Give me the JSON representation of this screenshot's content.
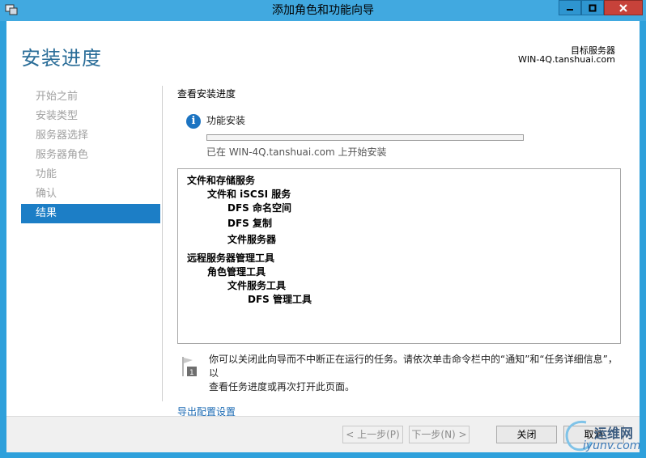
{
  "window": {
    "title": "添加角色和功能向导"
  },
  "header": {
    "title": "安装进度",
    "destination_label": "目标服务器",
    "destination_value": "WIN-4Q.tanshuai.com"
  },
  "nav": {
    "items": [
      {
        "label": "开始之前"
      },
      {
        "label": "安装类型"
      },
      {
        "label": "服务器选择"
      },
      {
        "label": "服务器角色"
      },
      {
        "label": "功能"
      },
      {
        "label": "确认"
      },
      {
        "label": "结果"
      }
    ]
  },
  "content": {
    "title": "查看安装进度",
    "status_label": "功能安装",
    "progress": 0,
    "status_text": "已在 WIN-4Q.tanshuai.com 上开始安装",
    "results": [
      "文件和存储服务",
      "文件和 iSCSI 服务",
      "DFS 命名空间",
      "DFS 复制",
      "文件服务器",
      "远程服务器管理工具",
      "角色管理工具",
      "文件服务工具",
      "DFS 管理工具"
    ],
    "note_line1": "你可以关闭此向导而不中断正在运行的任务。请依次单击命令栏中的“通知”和“任务详细信息”，以",
    "note_line2": "查看任务进度或再次打开此页面。",
    "export_link": "导出配置设置"
  },
  "footer": {
    "prev_label": "< 上一步(P)",
    "next_label": "下一步(N) >",
    "close_label": "关闭",
    "cancel_label": "取消"
  },
  "watermark": {
    "cn": "运维网",
    "en": "iyunv.com"
  }
}
